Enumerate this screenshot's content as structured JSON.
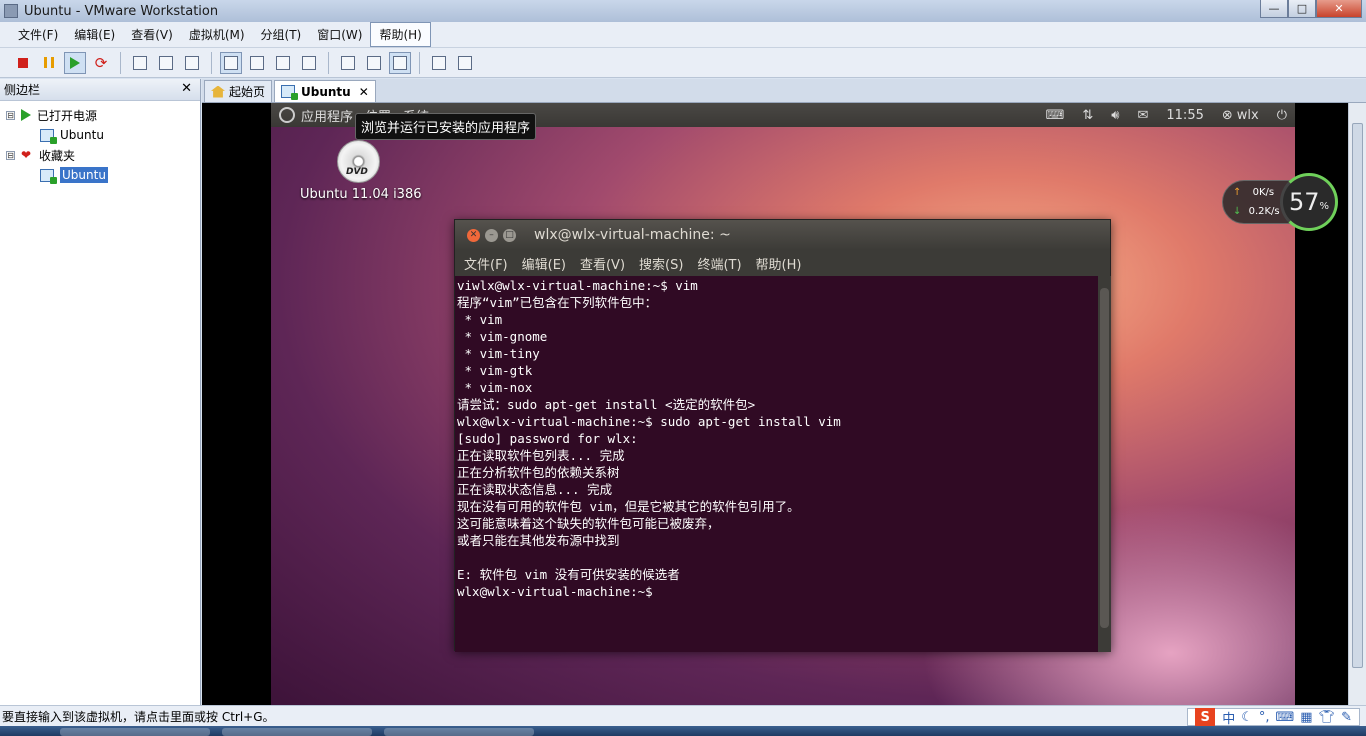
{
  "window": {
    "title": "Ubuntu - VMware Workstation",
    "controls": {
      "minimize": "—",
      "maximize": "□",
      "close": "✕"
    }
  },
  "menubar": {
    "items": [
      "文件(F)",
      "编辑(E)",
      "查看(V)",
      "虚拟机(M)",
      "分组(T)",
      "窗口(W)",
      "帮助(H)"
    ]
  },
  "sidebar": {
    "title": "侧边栏",
    "close": "✕",
    "groups": [
      {
        "label": "已打开电源",
        "expander": "⊟",
        "children": [
          "Ubuntu"
        ]
      },
      {
        "label": "收藏夹",
        "expander": "⊟",
        "children": [
          "Ubuntu"
        ]
      }
    ]
  },
  "tabs": [
    {
      "label": "起始页",
      "active": false
    },
    {
      "label": "Ubuntu",
      "active": true,
      "close": "✕"
    }
  ],
  "ubuntu_panel": {
    "menus": [
      "应用程序",
      "位置",
      "系统"
    ],
    "time": "11:55",
    "user": "wlx"
  },
  "tooltip": "浏览并运行已安装的应用程序",
  "desktop_icon": {
    "label": "Ubuntu 11.04 i386",
    "disc_text": "DVD"
  },
  "net_monitor": {
    "up": "0",
    "up_unit": "K/s",
    "down": "0.2",
    "down_unit": "K/s",
    "percent": "57",
    "percent_unit": "%"
  },
  "terminal": {
    "title": "wlx@wlx-virtual-machine: ~",
    "menus": [
      "文件(F)",
      "编辑(E)",
      "查看(V)",
      "搜索(S)",
      "终端(T)",
      "帮助(H)"
    ],
    "lines": [
      "viwlx@wlx-virtual-machine:~$ vim",
      "程序“vim”已包含在下列软件包中：",
      " * vim",
      " * vim-gnome",
      " * vim-tiny",
      " * vim-gtk",
      " * vim-nox",
      "请尝试：sudo apt-get install <选定的软件包>",
      "wlx@wlx-virtual-machine:~$ sudo apt-get install vim",
      "[sudo] password for wlx:",
      "正在读取软件包列表... 完成",
      "正在分析软件包的依赖关系树",
      "正在读取状态信息... 完成",
      "现在没有可用的软件包 vim，但是它被其它的软件包引用了。",
      "这可能意味着这个缺失的软件包可能已被废弃，",
      "或者只能在其他发布源中找到",
      "",
      "E: 软件包 vim 没有可供安装的候选者",
      "wlx@wlx-virtual-machine:~$"
    ]
  },
  "statusbar": {
    "text": "要直接输入到该虚拟机，请点击里面或按 Ctrl+G。",
    "ime": {
      "logo": "S",
      "mode": "中"
    }
  },
  "colors": {
    "terminal_bg": "#300a24",
    "selection": "#3a74c9",
    "vm_close_button": "#f0683a"
  }
}
